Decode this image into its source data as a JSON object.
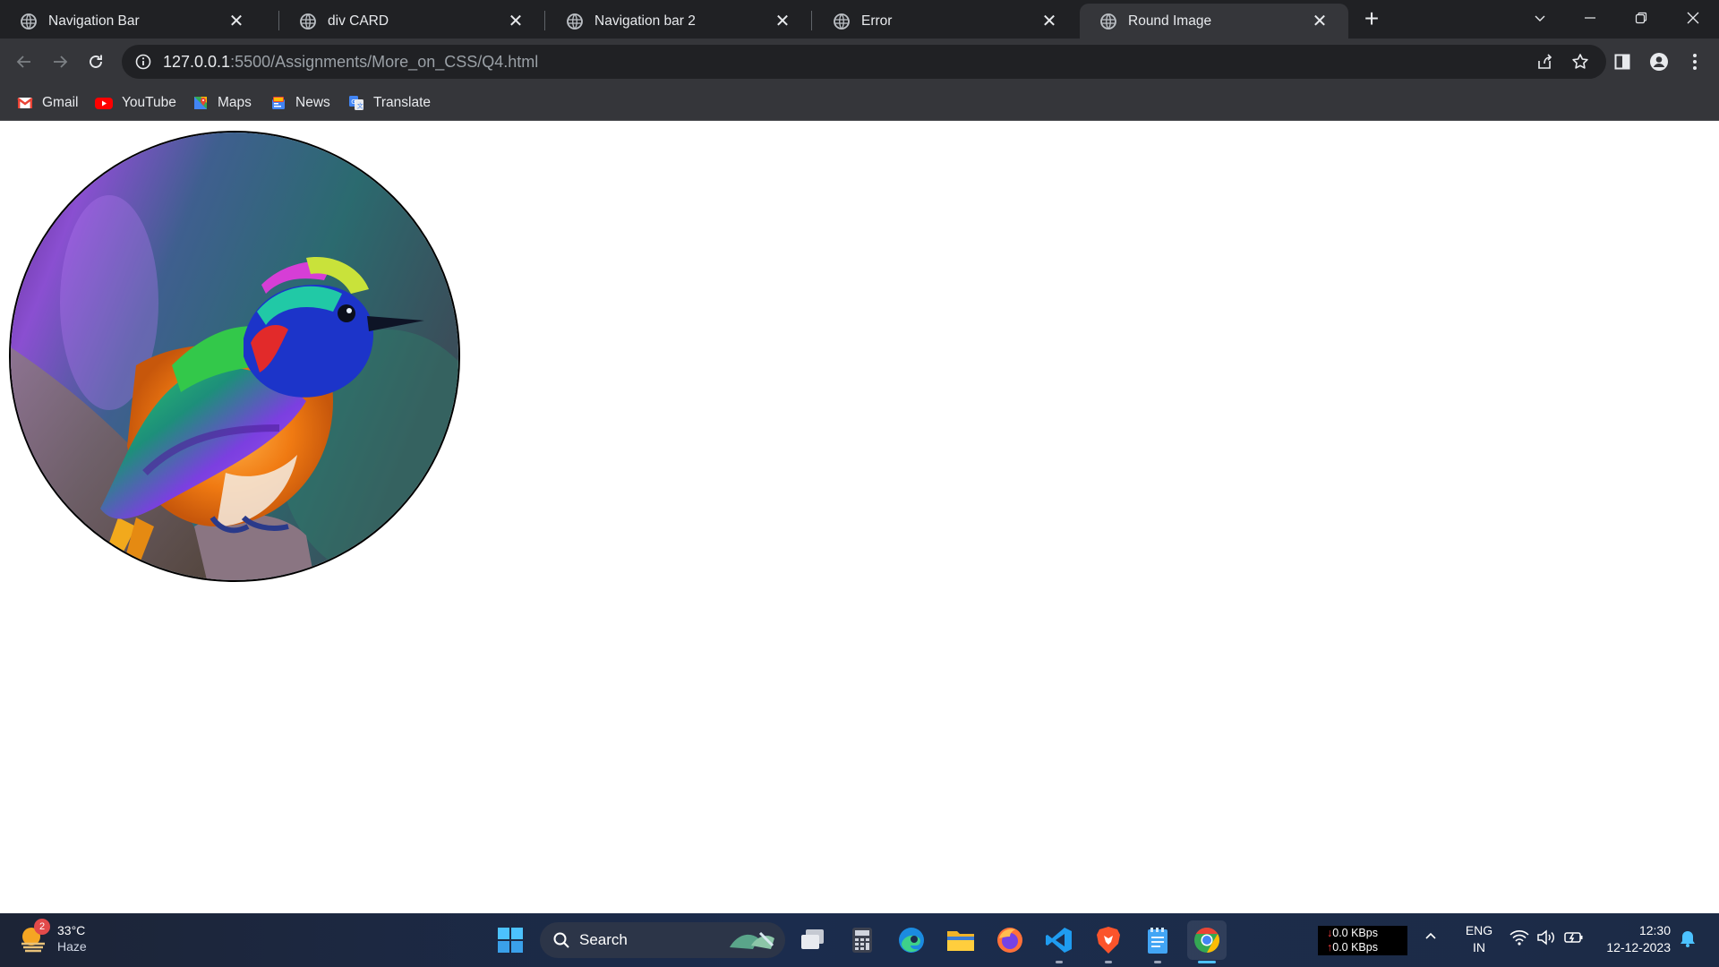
{
  "window": {
    "tabs": [
      {
        "title": "Navigation Bar",
        "active": false
      },
      {
        "title": "div CARD",
        "active": false
      },
      {
        "title": "Navigation bar 2",
        "active": false
      },
      {
        "title": "Error",
        "active": false
      },
      {
        "title": "Round Image",
        "active": true
      }
    ],
    "tab_close_glyph": "✕",
    "new_tab_glyph": "+"
  },
  "toolbar": {
    "url_host": "127.0.0.1",
    "url_rest": ":5500/Assignments/More_on_CSS/Q4.html"
  },
  "bookmarks": [
    {
      "label": "Gmail",
      "icon": "gmail-icon"
    },
    {
      "label": "YouTube",
      "icon": "youtube-icon"
    },
    {
      "label": "Maps",
      "icon": "maps-icon"
    },
    {
      "label": "News",
      "icon": "news-icon"
    },
    {
      "label": "Translate",
      "icon": "translate-icon"
    }
  ],
  "page": {
    "image_subject": "colorful bird perched on branch",
    "image_shape": "circle"
  },
  "taskbar": {
    "weather": {
      "temp": "33°C",
      "condition": "Haze",
      "badge": "2"
    },
    "search_label": "Search",
    "net_down": "0.0 KBps",
    "net_up": "0.0 KBps",
    "lang_top": "ENG",
    "lang_bottom": "IN",
    "time": "12:30",
    "date": "12-12-2023"
  },
  "colors": {
    "tab_strip": "#202124",
    "toolbar": "#35363a",
    "taskbar": "#1b2c4d",
    "accent": "#4cc2ff"
  }
}
